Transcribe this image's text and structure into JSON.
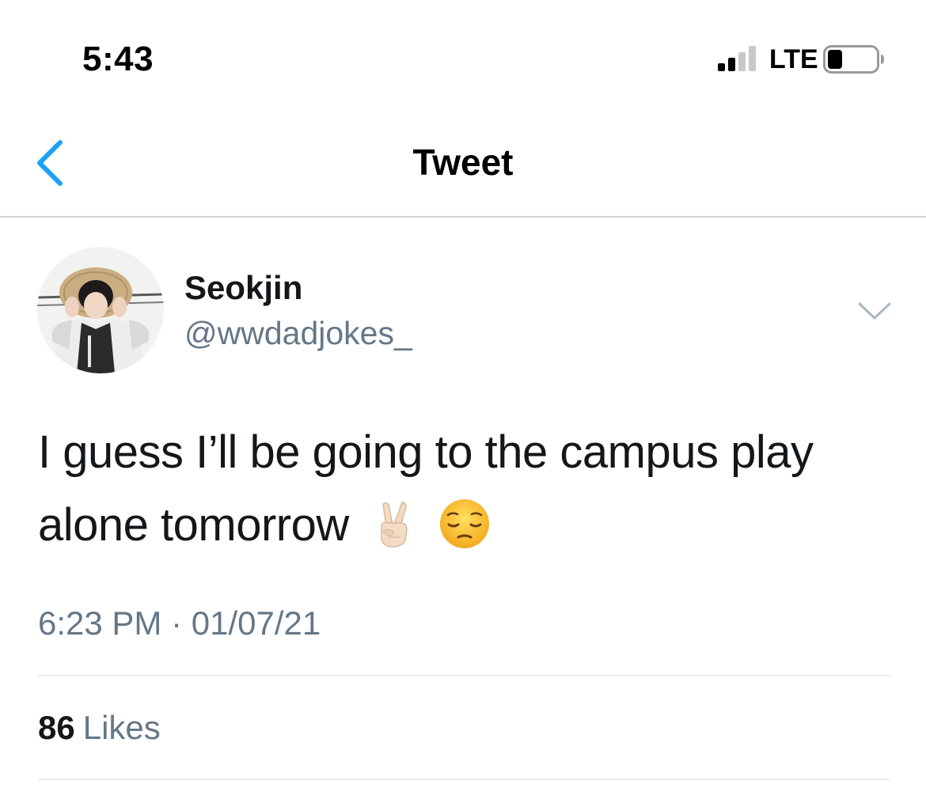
{
  "status_bar": {
    "time": "5:43",
    "network": "LTE",
    "signal_bars_filled": 2,
    "signal_bars_total": 4,
    "battery_icon": "battery-icon"
  },
  "nav": {
    "title": "Tweet",
    "back_icon": "chevron-left-icon"
  },
  "tweet": {
    "author": {
      "display_name": "Seokjin",
      "handle": "@wwdadjokes_",
      "avatar_icon": "avatar"
    },
    "text_line_1": "I guess I’ll be going to the campus play",
    "text_line_2": "alone tomorrow",
    "emojis": [
      "victory-hand-emoji",
      "pensive-face-emoji"
    ],
    "timestamp": "6:23 PM · 01/07/21",
    "likes_count": "86",
    "likes_label": "Likes"
  },
  "colors": {
    "accent": "#1da1f2",
    "text_primary": "#14171a",
    "text_secondary": "#657786",
    "divider": "#e6ecf0"
  }
}
